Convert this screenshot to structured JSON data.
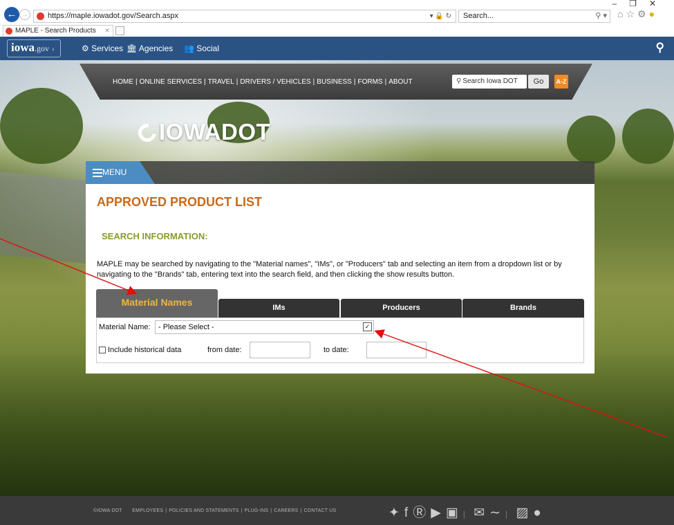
{
  "browser": {
    "url": "https://maple.iowadot.gov/Search.aspx",
    "search_placeholder": "Search...",
    "tab_title": "MAPLE - Search Products"
  },
  "gov_bar": {
    "logo": "iowa",
    "logo_suffix": ".gov",
    "links": [
      "Services",
      "Agencies",
      "Social"
    ]
  },
  "top_nav": {
    "links": [
      "HOME",
      "ONLINE SERVICES",
      "TRAVEL",
      "DRIVERS / VEHICLES",
      "BUSINESS",
      "FORMS",
      "ABOUT"
    ],
    "search_placeholder": "Search Iowa DOT",
    "go_label": "Go",
    "az_label": "A-Z"
  },
  "logo_text": "IOWADOT",
  "menu_label": "MENU",
  "page": {
    "title": "APPROVED PRODUCT LIST",
    "section_title": "SEARCH INFORMATION:",
    "description": "MAPLE may be searched by navigating to the \"Material names\", \"IMs\", or \"Producers\" tab and selecting an item from a dropdown list or by navigating to the \"Brands\" tab, entering text into the search field, and then clicking the show results button."
  },
  "tabs": [
    "Material Names",
    "IMs",
    "Producers",
    "Brands"
  ],
  "form": {
    "material_label": "Material Name:",
    "material_selected": "- Please Select -",
    "historical_label": "Include historical data",
    "historical_checked": false,
    "from_label": "from date:",
    "to_label": "to date:",
    "from_value": "",
    "to_value": ""
  },
  "footer": {
    "items": [
      "©IOWA DOT",
      "EMPLOYEES",
      "POLICIES AND STATEMENTS",
      "PLUG-INS",
      "CAREERS",
      "CONTACT US"
    ]
  },
  "icons": {
    "back": "back-arrow-icon",
    "forward": "forward-arrow-icon",
    "search": "search-icon",
    "social": [
      "twitter-icon",
      "facebook-icon",
      "pinterest-icon",
      "youtube-icon",
      "instagram-icon",
      "email-icon",
      "rss-icon",
      "android-icon",
      "apple-icon"
    ]
  },
  "colors": {
    "gov_bar": "#2a5384",
    "title_orange": "#c8691b",
    "section_green": "#8a9a2a",
    "active_tab_text": "#f0b445",
    "menu_blue": "#4b8cc2",
    "annotation_red": "#e01010"
  }
}
